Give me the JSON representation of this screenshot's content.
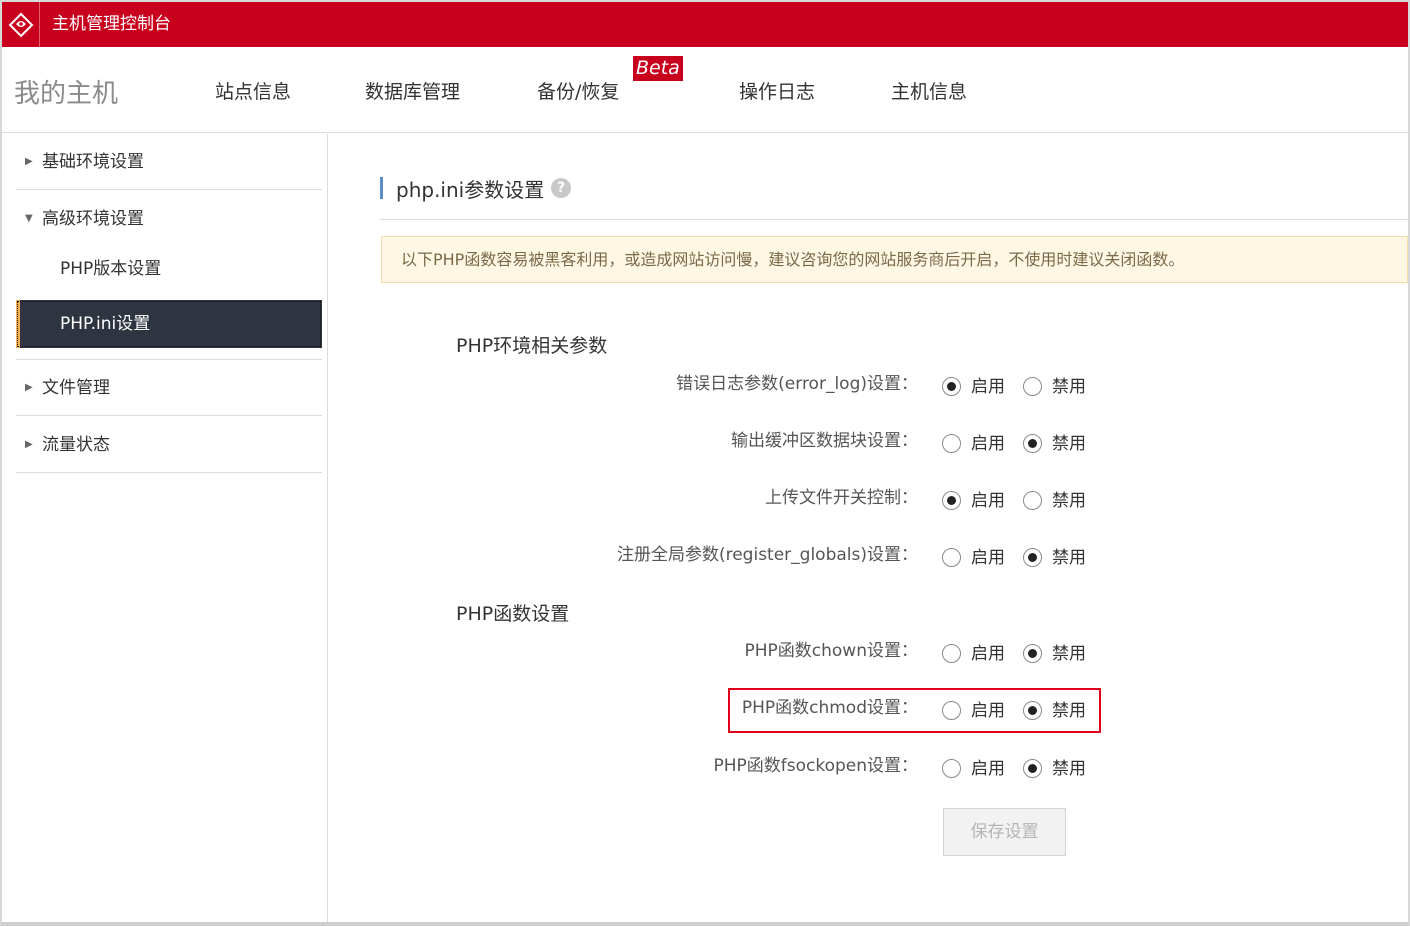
{
  "header": {
    "app_title": "主机管理控制台",
    "logo_icon": "brand-logo-icon"
  },
  "nav": {
    "brand": "我的主机",
    "items": [
      "站点信息",
      "数据库管理",
      "备份/恢复",
      "操作日志",
      "主机信息"
    ],
    "beta_badge": "Beta"
  },
  "sidebar": {
    "groups": [
      {
        "label": "基础环境设置",
        "expanded": false
      },
      {
        "label": "高级环境设置",
        "expanded": true,
        "children": [
          {
            "label": "PHP版本设置",
            "active": false
          },
          {
            "label": "PHP.ini设置",
            "active": true
          }
        ]
      },
      {
        "label": "文件管理",
        "expanded": false
      },
      {
        "label": "流量状态",
        "expanded": false
      }
    ]
  },
  "main": {
    "title": "php.ini参数设置",
    "help_glyph": "?",
    "notice": "以下PHP函数容易被黑客利用，或造成网站访问慢，建议咨询您的网站服务商后开启，不使用时建议关闭函数。",
    "option_on": "启用",
    "option_off": "禁用",
    "env_group": {
      "title": "PHP环境相关参数",
      "rows": [
        {
          "label": "错误日志参数(error_log)设置：",
          "value": "on"
        },
        {
          "label": "输出缓冲区数据块设置：",
          "value": "off"
        },
        {
          "label": "上传文件开关控制：",
          "value": "on"
        },
        {
          "label": "注册全局参数(register_globals)设置：",
          "value": "off"
        }
      ]
    },
    "func_group": {
      "title": "PHP函数设置",
      "rows": [
        {
          "label": "PHP函数chown设置：",
          "value": "off"
        },
        {
          "label": "PHP函数chmod设置：",
          "value": "off",
          "highlighted": true
        },
        {
          "label": "PHP函数fsockopen设置：",
          "value": "off"
        }
      ]
    },
    "save_label": "保存设置"
  },
  "colors": {
    "header_red": "#c8001e",
    "sidebar_active": "#2e3440",
    "active_accent": "#f2b04e",
    "highlight": "#e0001b"
  }
}
